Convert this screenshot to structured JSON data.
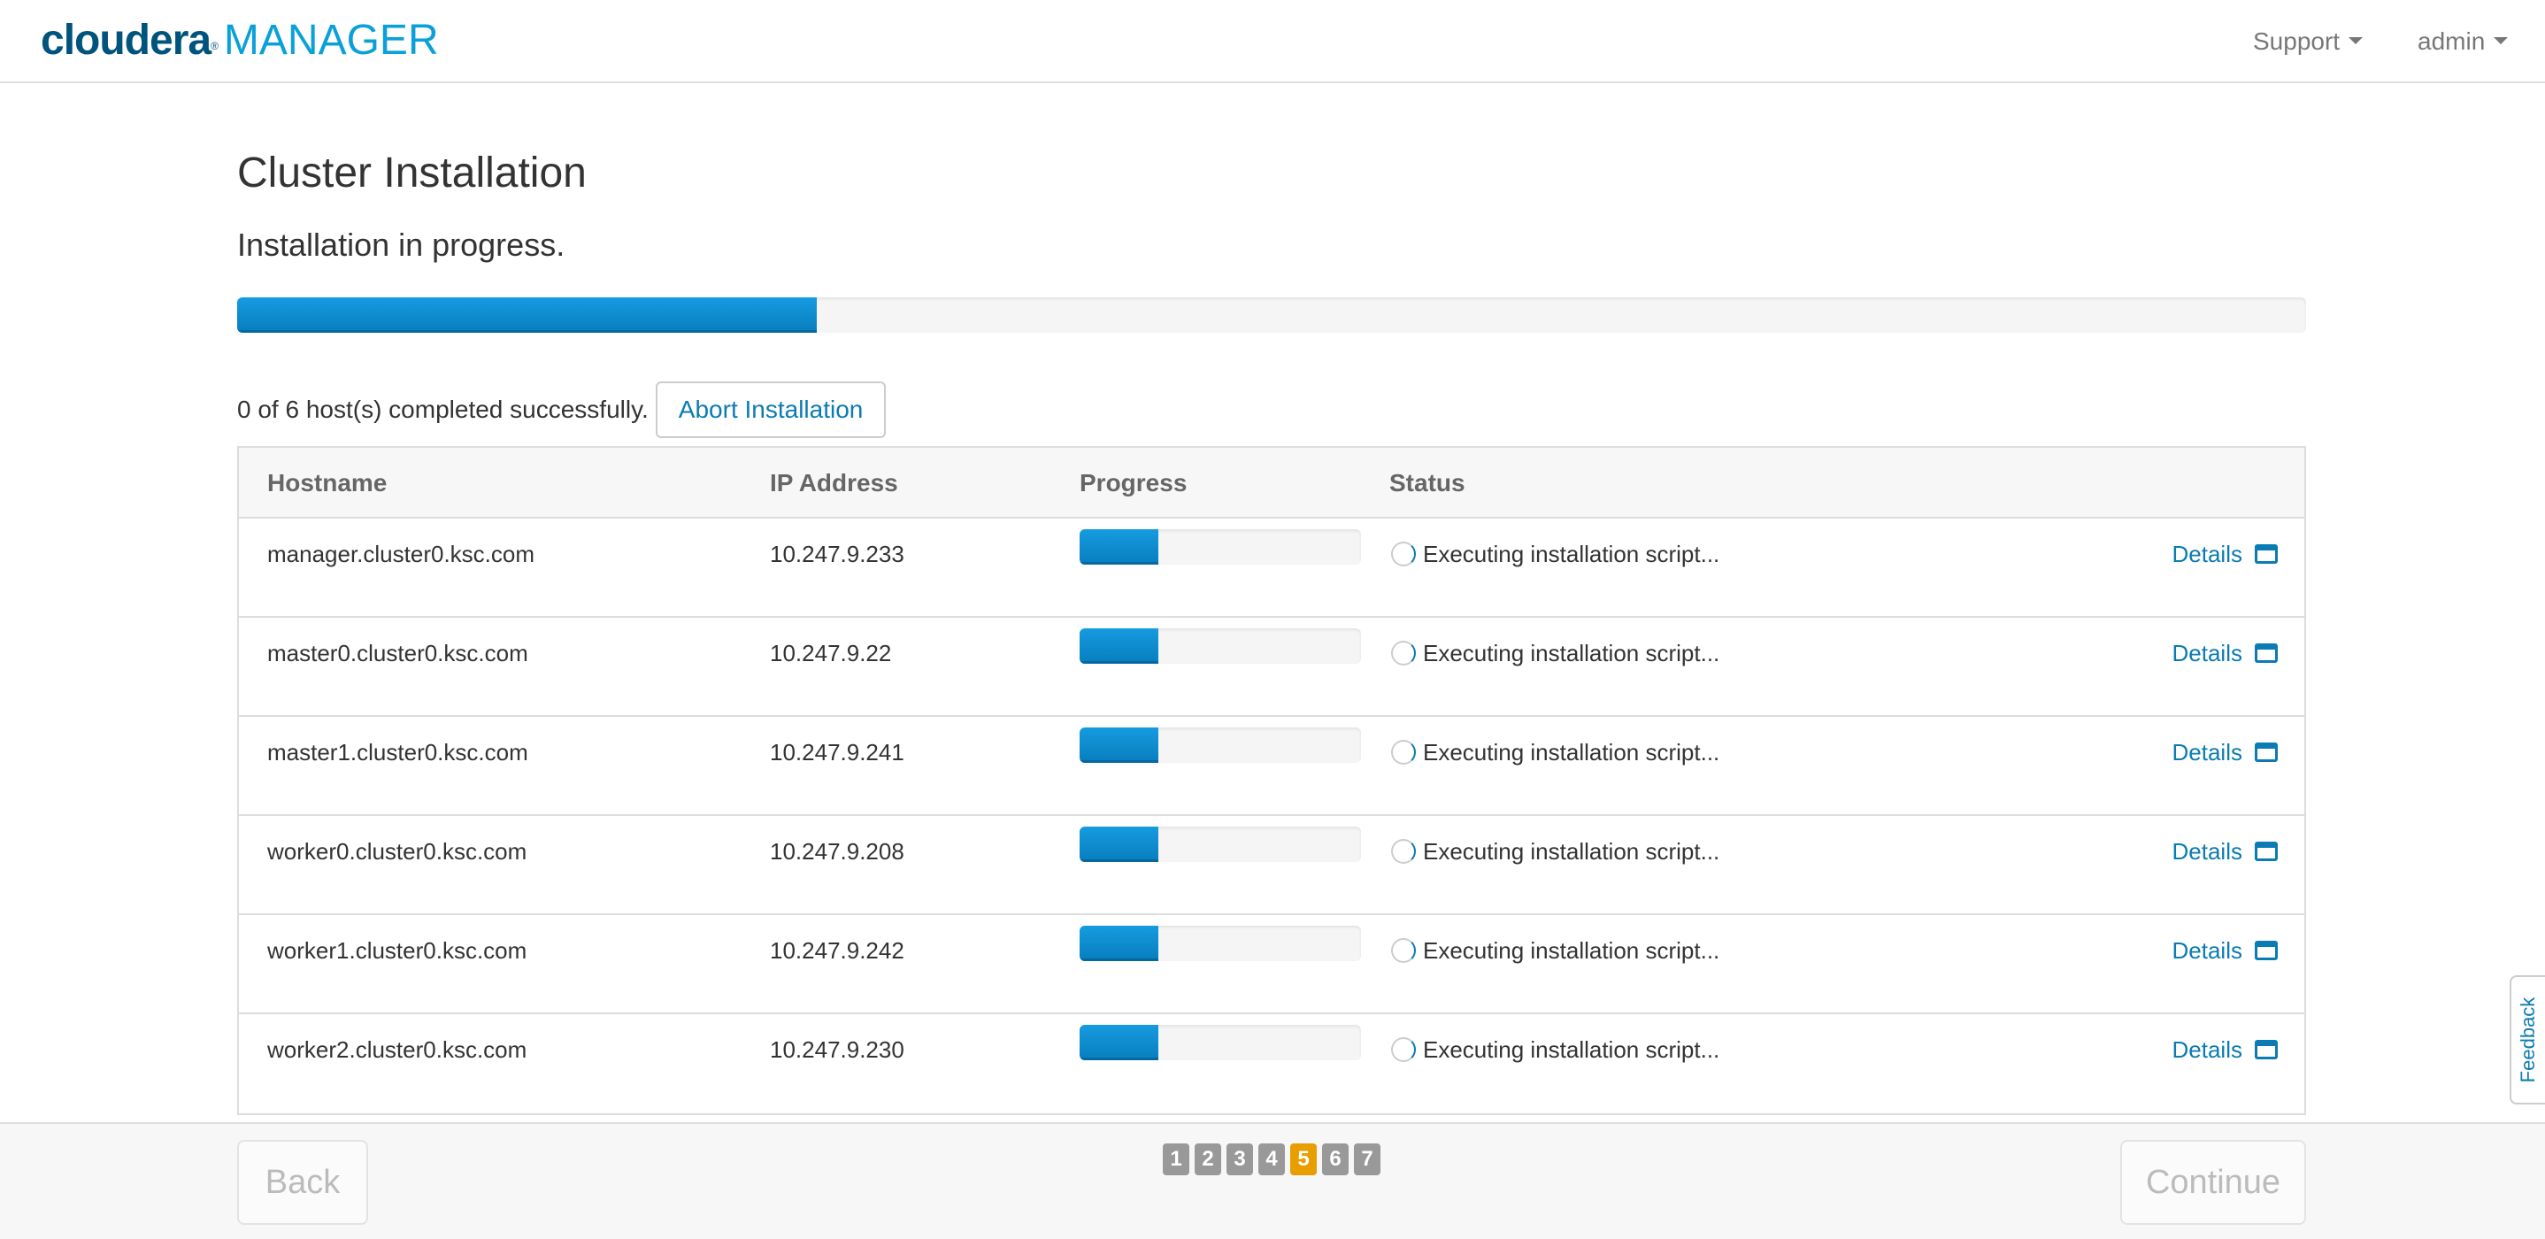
{
  "header": {
    "brand": "cloudera",
    "product": "MANAGER",
    "menus": [
      {
        "label": "Support"
      },
      {
        "label": "admin"
      }
    ]
  },
  "page": {
    "title": "Cluster Installation",
    "subtitle": "Installation in progress.",
    "overall_progress_percent": 28,
    "summary": "0 of 6 host(s) completed successfully.",
    "abort_label": "Abort Installation"
  },
  "table": {
    "columns": [
      "Hostname",
      "IP Address",
      "Progress",
      "Status"
    ],
    "rows": [
      {
        "hostname": "manager.cluster0.ksc.com",
        "ip": "10.247.9.233",
        "progress_percent": 28,
        "status": "Executing installation script...",
        "details": "Details"
      },
      {
        "hostname": "master0.cluster0.ksc.com",
        "ip": "10.247.9.22",
        "progress_percent": 28,
        "status": "Executing installation script...",
        "details": "Details"
      },
      {
        "hostname": "master1.cluster0.ksc.com",
        "ip": "10.247.9.241",
        "progress_percent": 28,
        "status": "Executing installation script...",
        "details": "Details"
      },
      {
        "hostname": "worker0.cluster0.ksc.com",
        "ip": "10.247.9.208",
        "progress_percent": 28,
        "status": "Executing installation script...",
        "details": "Details"
      },
      {
        "hostname": "worker1.cluster0.ksc.com",
        "ip": "10.247.9.242",
        "progress_percent": 28,
        "status": "Executing installation script...",
        "details": "Details"
      },
      {
        "hostname": "worker2.cluster0.ksc.com",
        "ip": "10.247.9.230",
        "progress_percent": 28,
        "status": "Executing installation script...",
        "details": "Details"
      }
    ]
  },
  "footer": {
    "back_label": "Back",
    "continue_label": "Continue",
    "steps": [
      "1",
      "2",
      "3",
      "4",
      "5",
      "6",
      "7"
    ],
    "active_step": "5"
  },
  "feedback_label": "Feedback",
  "colors": {
    "accent": "#0a7bb3",
    "progress": "#169be0",
    "active_step": "#e89e00",
    "brand_dark": "#00537c",
    "brand_light": "#0aa0d8"
  }
}
